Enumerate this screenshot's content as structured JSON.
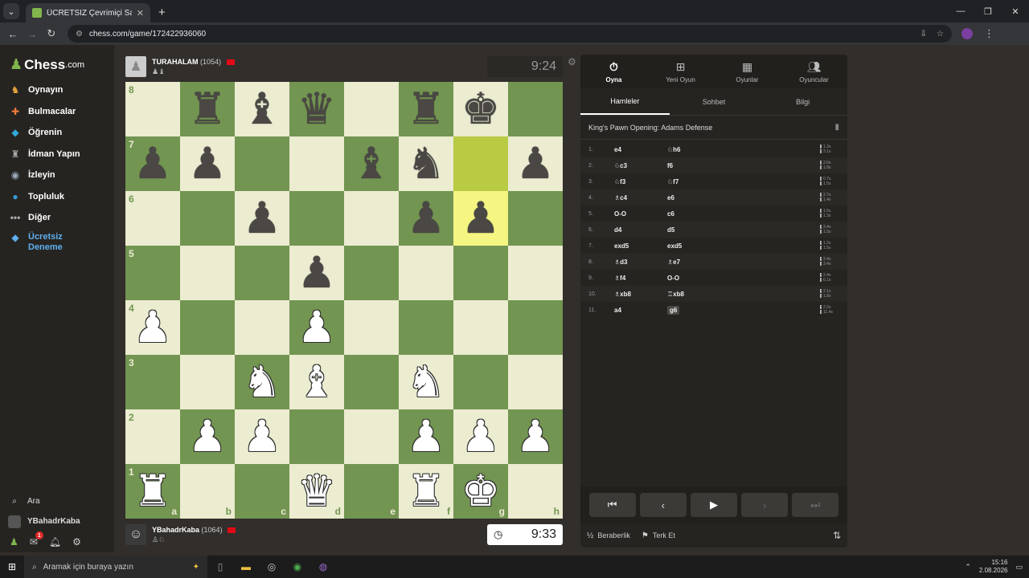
{
  "browser": {
    "tab_title": "ÜCRETSİZ Çevrimiçi Satranç Oy...",
    "url": "chess.com/game/172422936060"
  },
  "sidebar": {
    "logo": "Chess",
    "logo_suffix": ".com",
    "items": [
      {
        "label": "Oynayın",
        "icon": "chessboard-hand-icon"
      },
      {
        "label": "Bulmacalar",
        "icon": "puzzle-icon"
      },
      {
        "label": "Öğrenin",
        "icon": "graduation-cap-icon"
      },
      {
        "label": "İdman Yapın",
        "icon": "dumbbell-icon"
      },
      {
        "label": "İzleyin",
        "icon": "binoculars-icon"
      },
      {
        "label": "Topluluk",
        "icon": "globe-icon"
      },
      {
        "label": "Diğer",
        "icon": "more-dots-icon"
      }
    ],
    "trial_label": "Ücretsiz Deneme",
    "search_label": "Ara",
    "username": "YBahadrKaba",
    "notification_count": "1"
  },
  "opponent": {
    "name": "TURAHALAM",
    "rating": "(1054)",
    "captured": "♟♝",
    "clock": "9:24"
  },
  "player": {
    "name": "YBahadrKaba",
    "rating": "(1064)",
    "captured": "♙♘",
    "clock": "9:33"
  },
  "board": {
    "files": [
      "a",
      "b",
      "c",
      "d",
      "e",
      "f",
      "g",
      "h"
    ],
    "ranks": [
      "8",
      "7",
      "6",
      "5",
      "4",
      "3",
      "2",
      "1"
    ]
  },
  "panel": {
    "tabs": [
      "Oyna",
      "Yeni Oyun",
      "Oyunlar",
      "Oyuncular"
    ],
    "subtabs": [
      "Hamleler",
      "Sohbet",
      "Bilgi"
    ],
    "opening": "King's Pawn Opening: Adams Defense",
    "moves": [
      {
        "n": "1.",
        "w": "e4",
        "b": "♘h6",
        "wt": "1.3s",
        "bt": "3.1s"
      },
      {
        "n": "2.",
        "w": "♘c3",
        "b": "f6",
        "wt": "2.0s",
        "bt": "1.8s"
      },
      {
        "n": "3.",
        "w": "♘f3",
        "b": "♘f7",
        "wt": "0.7s",
        "bt": "1.5s"
      },
      {
        "n": "4.",
        "w": "♗c4",
        "b": "e6",
        "wt": "2.7s",
        "bt": "1.4s"
      },
      {
        "n": "5.",
        "w": "O-O",
        "b": "c6",
        "wt": "1.5s",
        "bt": "1.3s"
      },
      {
        "n": "6.",
        "w": "d4",
        "b": "d5",
        "wt": "3.4s",
        "bt": "1.5s"
      },
      {
        "n": "7.",
        "w": "exd5",
        "b": "exd5",
        "wt": "1.2s",
        "bt": "1.5s"
      },
      {
        "n": "8.",
        "w": "♗d3",
        "b": "♗e7",
        "wt": "2.4s",
        "bt": "3.4s"
      },
      {
        "n": "9.",
        "w": "♗f4",
        "b": "O-O",
        "wt": "2.4s",
        "bt": "6.1s"
      },
      {
        "n": "10.",
        "w": "♗xb8",
        "b": "♖xb8",
        "wt": "2.1s",
        "bt": "1.8s"
      },
      {
        "n": "11.",
        "w": "a4",
        "b": "g6",
        "wt": "2.2s",
        "bt": "11.4s"
      }
    ],
    "draw_label": "Beraberlik",
    "resign_label": "Terk Et"
  },
  "taskbar": {
    "search_placeholder": "Aramak için buraya yazın",
    "time": "15:16",
    "date": "2.08.2026"
  },
  "colors": {
    "light_square": "#ebecd0",
    "dark_square": "#739552",
    "highlight_light": "#f5f682",
    "highlight_dark": "#b9ca43",
    "accent_green": "#81b64c"
  }
}
